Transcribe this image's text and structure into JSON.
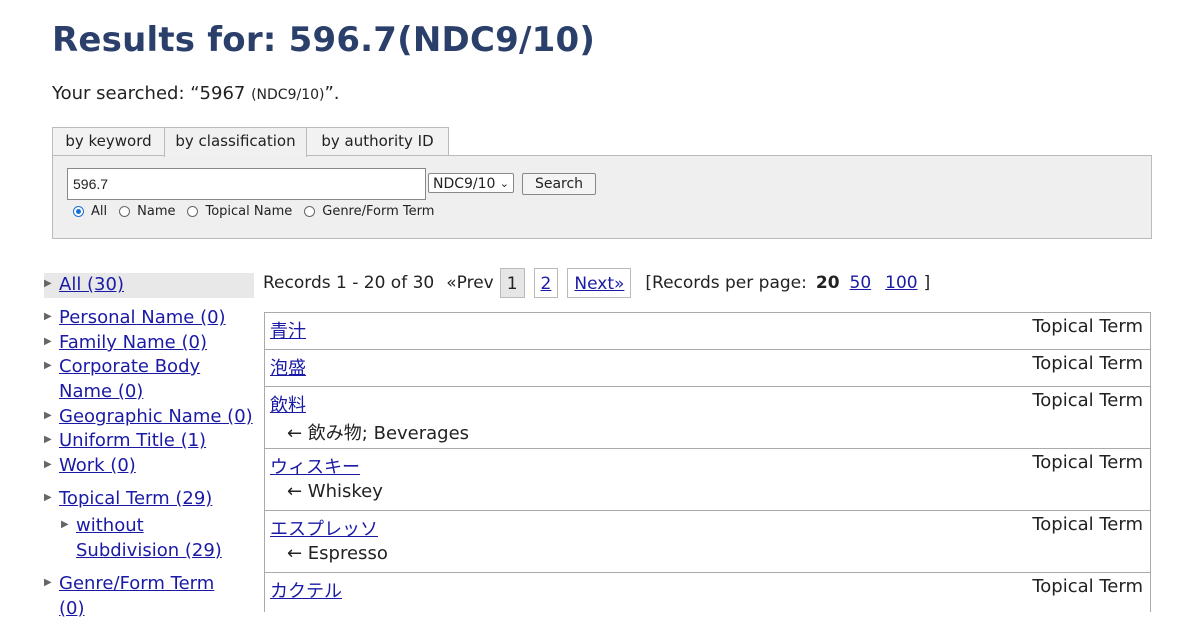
{
  "page": {
    "title": "Results for: 596.7(NDC9/10)",
    "searched_prefix": "Your searched: “5967 ",
    "searched_small": "(NDC9/10)",
    "searched_suffix": "”."
  },
  "tabs": [
    "by keyword",
    "by classification",
    "by authority ID"
  ],
  "search": {
    "query": "596.7",
    "scheme": "NDC9/10",
    "button": "Search",
    "radios": [
      "All",
      "Name",
      "Topical Name",
      "Genre/Form Term"
    ],
    "selected_radio": "All"
  },
  "facets": [
    "All (30)",
    "Personal Name (0)",
    "Family Name (0)",
    "Corporate Body",
    "Name (0)",
    "Geographic Name (0)",
    "Uniform Title (1)",
    "Work (0)",
    "Topical Term (29)",
    "without",
    "Subdivision (29)",
    "Genre/Form Term",
    "(0)"
  ],
  "pager": {
    "records": "Records 1 - 20 of 30",
    "prev": "«Prev",
    "pages": [
      "1",
      "2"
    ],
    "next": "Next»",
    "per_page_label": "[Records per page:",
    "per_page_options": [
      "20",
      "50",
      "100"
    ],
    "per_page_close": "]"
  },
  "results": [
    {
      "heading": "青汁",
      "type": "Topical Term",
      "see": ""
    },
    {
      "heading": "泡盛",
      "type": "Topical Term",
      "see": ""
    },
    {
      "heading": "飲料",
      "type": "Topical Term",
      "see": "← 飲み物; Beverages"
    },
    {
      "heading": "ウィスキー",
      "type": "Topical Term",
      "see": "← Whiskey"
    },
    {
      "heading": "エスプレッソ",
      "type": "Topical Term",
      "see": "← Espresso"
    },
    {
      "heading": "カクテル",
      "type": "Topical Term",
      "see": ""
    }
  ],
  "colors": {
    "title": "#2b3f6b",
    "link": "#1a1aa6",
    "radio_accent": "#1a6fd6"
  }
}
